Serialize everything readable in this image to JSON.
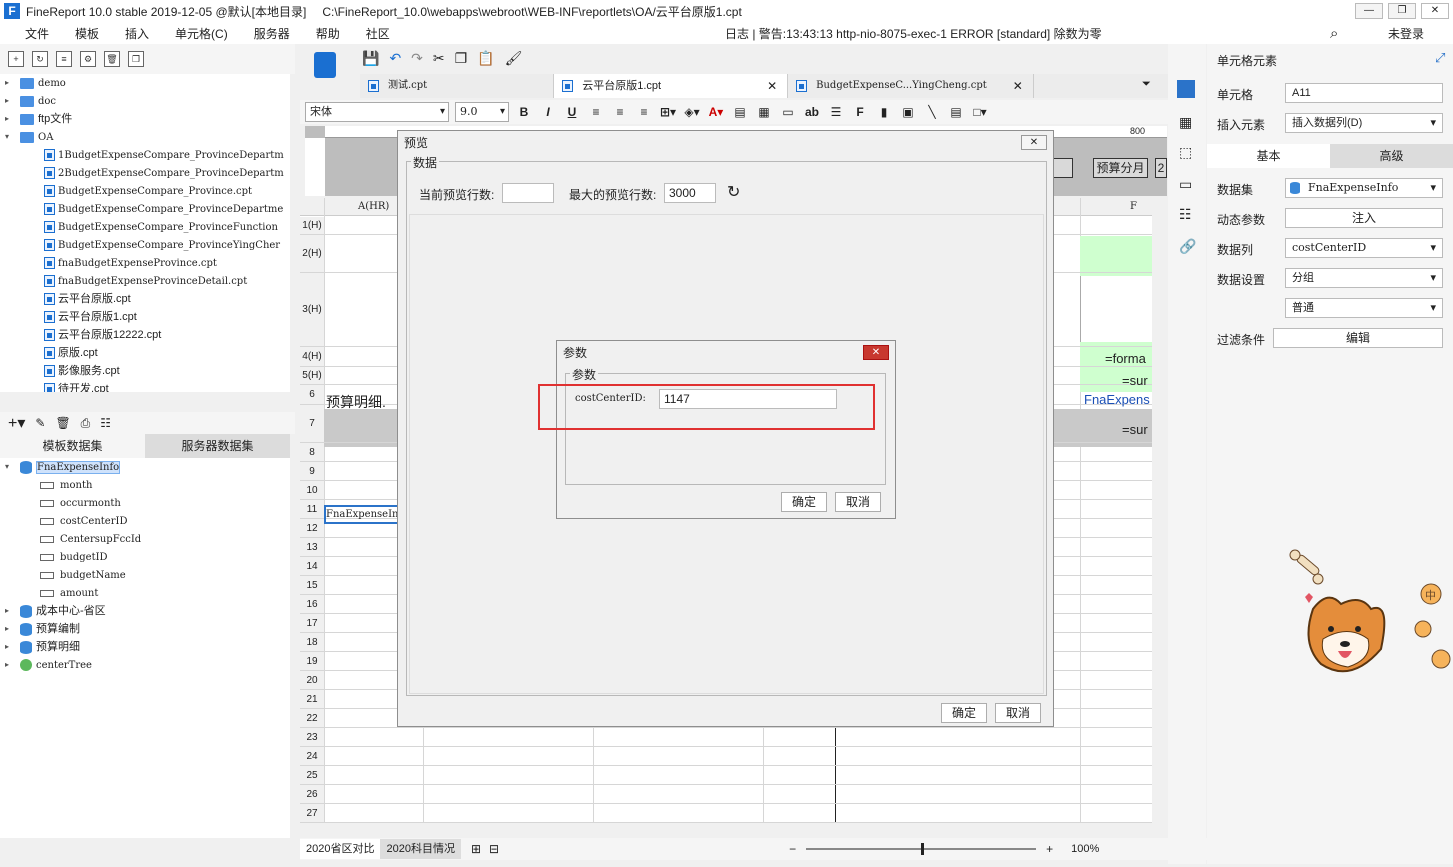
{
  "window": {
    "title": "FineReport 10.0 stable 2019-12-05 @默认[本地目录]",
    "path": "C:\\FineReport_10.0\\webapps\\webroot\\WEB-INF\\reportlets\\OA/云平台原版1.cpt"
  },
  "menu": [
    "文件",
    "模板",
    "插入",
    "单元格(C)",
    "服务器",
    "帮助",
    "社区"
  ],
  "log_line": "日志 | 警告:13:43:13 http-nio-8075-exec-1 ERROR [standard] 除数为零",
  "login": "未登录",
  "tree": [
    {
      "t": "folder",
      "label": "demo"
    },
    {
      "t": "folder",
      "label": "doc"
    },
    {
      "t": "folder",
      "label": "ftp文件"
    },
    {
      "t": "folder",
      "label": "OA"
    },
    {
      "t": "cpt",
      "label": "1BudgetExpenseCompare_ProvinceDepartm"
    },
    {
      "t": "cpt",
      "label": "2BudgetExpenseCompare_ProvinceDepartm"
    },
    {
      "t": "cpt",
      "label": "BudgetExpenseCompare_Province.cpt"
    },
    {
      "t": "cpt",
      "label": "BudgetExpenseCompare_ProvinceDepartme"
    },
    {
      "t": "cpt",
      "label": "BudgetExpenseCompare_ProvinceFunction"
    },
    {
      "t": "cpt",
      "label": "BudgetExpenseCompare_ProvinceYingCher"
    },
    {
      "t": "cpt",
      "label": "fnaBudgetExpenseProvince.cpt"
    },
    {
      "t": "cpt",
      "label": "fnaBudgetExpenseProvinceDetail.cpt"
    },
    {
      "t": "cpt",
      "label": "云平台原版.cpt"
    },
    {
      "t": "cpt",
      "label": "云平台原版1.cpt"
    },
    {
      "t": "cpt",
      "label": "云平台原版12222.cpt"
    },
    {
      "t": "cpt",
      "label": "原版.cpt"
    },
    {
      "t": "cpt",
      "label": "影像服务.cpt"
    },
    {
      "t": "cpt",
      "label": "待开发.cpt"
    }
  ],
  "ds_tabs": [
    "模板数据集",
    "服务器数据集"
  ],
  "ds": [
    {
      "t": "db",
      "label": "FnaExpenseInfo"
    },
    {
      "t": "f",
      "label": "month"
    },
    {
      "t": "f",
      "label": "occurmonth"
    },
    {
      "t": "f",
      "label": "costCenterID"
    },
    {
      "t": "f",
      "label": "CentersupFccId"
    },
    {
      "t": "f",
      "label": "budgetID"
    },
    {
      "t": "f",
      "label": "budgetName"
    },
    {
      "t": "f",
      "label": "amount"
    },
    {
      "t": "db",
      "label": "成本中心-省区"
    },
    {
      "t": "db",
      "label": "预算编制"
    },
    {
      "t": "db",
      "label": "预算明细"
    },
    {
      "t": "tree",
      "label": "centerTree"
    }
  ],
  "tabs": [
    "测试.cpt",
    "云平台原版1.cpt",
    "BudgetExpenseC...YingCheng.cpt"
  ],
  "font": {
    "name": "宋体",
    "size": "9.0"
  },
  "ruler": {
    "mark800": "800",
    "btn": "预算分月",
    "btn2": "2"
  },
  "sheet": {
    "colA": "A(HR)",
    "colF": "F",
    "rows": [
      "1(H)",
      "2(H)",
      "3(H)",
      "4(H)",
      "5(H)",
      "6",
      "7",
      "8",
      "9",
      "10",
      "11",
      "12",
      "13",
      "14",
      "15",
      "16",
      "17",
      "18",
      "19",
      "20",
      "21",
      "22",
      "23",
      "24",
      "25",
      "26",
      "27"
    ],
    "c6a": "预算明细.",
    "c11a": "FnaExpenseIn",
    "f4": "=forma",
    "f5": "=sur",
    "f6": "FnaExpens",
    "f7": "=sur"
  },
  "sheet_tabs": [
    "2020省区对比",
    "2020科目情况"
  ],
  "zoom": "100%",
  "rp": {
    "title": "单元格元素",
    "cell_lbl": "单元格",
    "cell_val": "A11",
    "insert_lbl": "插入元素",
    "insert_val": "插入数据列(D)",
    "tab_basic": "基本",
    "tab_adv": "高级",
    "ds_lbl": "数据集",
    "ds_val": "FnaExpenseInfo",
    "dyn_lbl": "动态参数",
    "dyn_btn": "注入",
    "col_lbl": "数据列",
    "col_val": "costCenterID",
    "set_lbl": "数据设置",
    "set_val": "分组",
    "set_val2": "普通",
    "filter_lbl": "过滤条件",
    "filter_btn": "编辑"
  },
  "preview": {
    "title": "预览",
    "group": "数据",
    "cur_lbl": "当前预览行数:",
    "max_lbl": "最大的预览行数:",
    "max_val": "3000",
    "ok": "确定",
    "cancel": "取消"
  },
  "param": {
    "title": "参数",
    "group": "参数",
    "name": "costCenterID:",
    "value": "1147",
    "ok": "确定",
    "cancel": "取消"
  }
}
